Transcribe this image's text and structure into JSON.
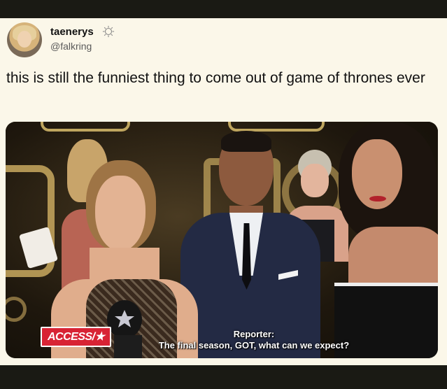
{
  "tweet": {
    "display_name": "taenerys",
    "verified_icon": "sparkle-badge-icon",
    "handle": "@falkring",
    "text": "this is still the funniest thing to come out of game of thrones ever"
  },
  "image": {
    "alt_icon": "hbo-logo-background",
    "caption_speaker": "Reporter:",
    "caption_line": "The final season, GOT, what can we expect?",
    "brand_logo": "ACCESS/★"
  },
  "colors": {
    "background": "#fbf7e9",
    "frame": "#1a1a14",
    "access_red": "#d82334",
    "hbo_gold": "#c9a95f"
  }
}
